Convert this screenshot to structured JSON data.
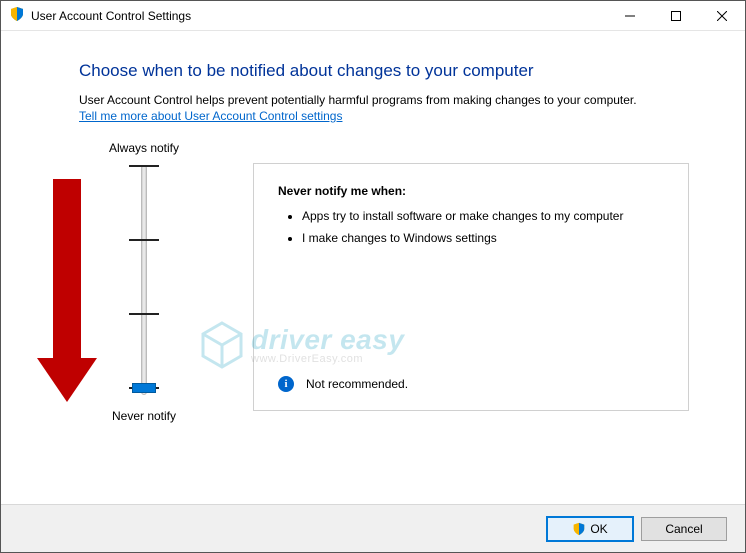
{
  "window": {
    "title": "User Account Control Settings"
  },
  "header": {
    "heading": "Choose when to be notified about changes to your computer",
    "description": "User Account Control helps prevent potentially harmful programs from making changes to your computer.",
    "link": "Tell me more about User Account Control settings"
  },
  "slider": {
    "top_label": "Always notify",
    "bottom_label": "Never notify",
    "value_index": 3,
    "steps": 4
  },
  "info": {
    "title": "Never notify me when:",
    "bullets": [
      "Apps try to install software or make changes to my computer",
      "I make changes to Windows settings"
    ],
    "recommendation": "Not recommended."
  },
  "footer": {
    "ok": "OK",
    "cancel": "Cancel"
  },
  "watermark": {
    "line1": "driver easy",
    "line2": "www.DriverEasy.com"
  }
}
